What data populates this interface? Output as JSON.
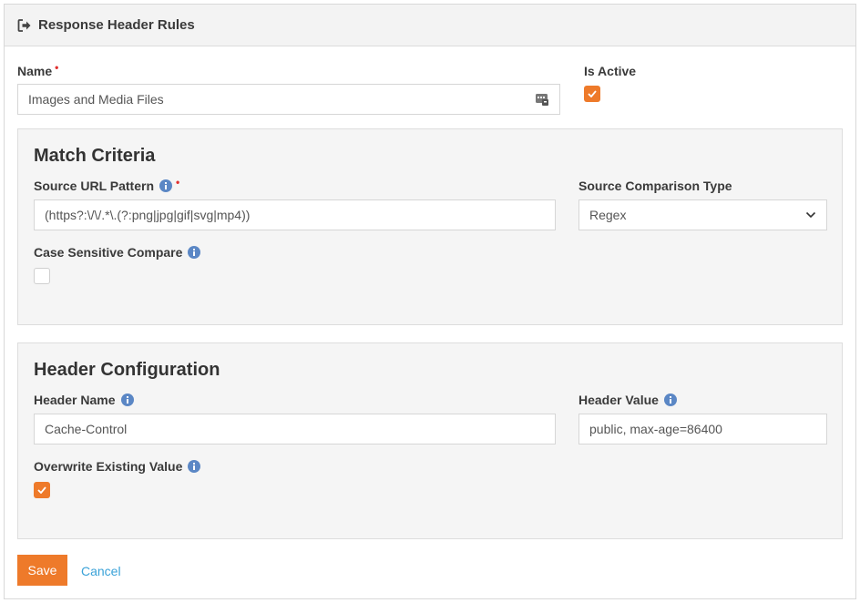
{
  "header": {
    "title": "Response Header Rules",
    "icon": "sign-out-icon"
  },
  "form": {
    "name": {
      "label": "Name",
      "required_mark": "•",
      "value": "Images and Media Files",
      "field_icon": "contact-card-icon"
    },
    "is_active": {
      "label": "Is Active",
      "checked": true
    }
  },
  "match_criteria": {
    "title": "Match Criteria",
    "source_url_pattern": {
      "label": "Source URL Pattern",
      "required_mark": "•",
      "value": "(https?:\\/\\/.*\\.(?:png|jpg|gif|svg|mp4))"
    },
    "source_comparison_type": {
      "label": "Source Comparison Type",
      "selected": "Regex"
    },
    "case_sensitive": {
      "label": "Case Sensitive Compare",
      "checked": false
    }
  },
  "header_configuration": {
    "title": "Header Configuration",
    "header_name": {
      "label": "Header Name",
      "value": "Cache-Control"
    },
    "header_value": {
      "label": "Header Value",
      "value": "public, max-age=86400"
    },
    "overwrite_existing": {
      "label": "Overwrite Existing Value",
      "checked": true
    }
  },
  "actions": {
    "save_label": "Save",
    "cancel_label": "Cancel"
  },
  "colors": {
    "accent": "#ee7a2a",
    "link": "#3aa2d8",
    "info": "#5b87c5",
    "required": "#e0302f"
  }
}
